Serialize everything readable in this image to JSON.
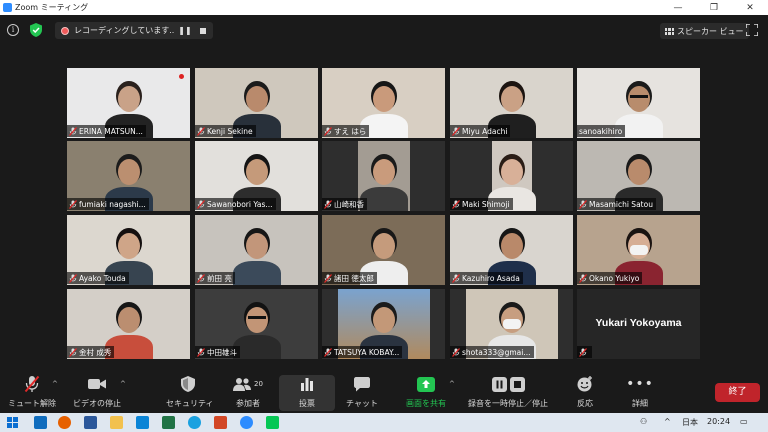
{
  "window": {
    "title": "Zoom ミーティング",
    "minimize": "—",
    "maximize": "❐",
    "close": "✕"
  },
  "topbar": {
    "recording_text": "レコーディングしています...",
    "pause_glyph": "❚❚",
    "speaker_view": "スピーカー ビュー"
  },
  "participants": [
    {
      "name": "ERINA MATSUN...",
      "muted": true
    },
    {
      "name": "Kenji Sekine",
      "muted": true
    },
    {
      "name": "すえ はら",
      "muted": true
    },
    {
      "name": "Miyu Adachi",
      "muted": true
    },
    {
      "name": "sanoakihiro",
      "muted": false,
      "active_speaker": true
    },
    {
      "name": "fumiaki nagashi...",
      "muted": true
    },
    {
      "name": "Sawanobori Yas...",
      "muted": true
    },
    {
      "name": "山崎和香",
      "muted": true
    },
    {
      "name": "Maki Shimoji",
      "muted": true
    },
    {
      "name": "Masamichi Satou",
      "muted": true
    },
    {
      "name": "Ayako Touda",
      "muted": true
    },
    {
      "name": "前田 亮",
      "muted": true
    },
    {
      "name": "諸田 徳太郎",
      "muted": true
    },
    {
      "name": "Kazuhiro Asada",
      "muted": true
    },
    {
      "name": "Okano Yukiyo",
      "muted": true
    },
    {
      "name": "金村 成秀",
      "muted": true
    },
    {
      "name": "中田雄斗",
      "muted": true
    },
    {
      "name": "TATSUYA KOBAY...",
      "muted": true
    },
    {
      "name": "shota333@gmai...",
      "muted": true
    },
    {
      "name": "Yukari Yokoyama",
      "muted": true,
      "video_off": true
    }
  ],
  "toolbar": {
    "unmute": "ミュート解除",
    "stop_video": "ビデオの停止",
    "security": "セキュリティ",
    "participants": "参加者",
    "participants_count": "20",
    "polls": "投票",
    "chat": "チャット",
    "share_screen": "画面を共有",
    "pause_stop_recording": "録音を一時停止／停止",
    "reactions": "反応",
    "more": "詳細",
    "end": "終了"
  },
  "taskbar": {
    "language": "日本",
    "time": "20:24"
  },
  "colors": {
    "active_outline": "#b9d65a",
    "end_button": "#c0242b",
    "share_green": "#23c552",
    "mute_red": "#e02828"
  }
}
